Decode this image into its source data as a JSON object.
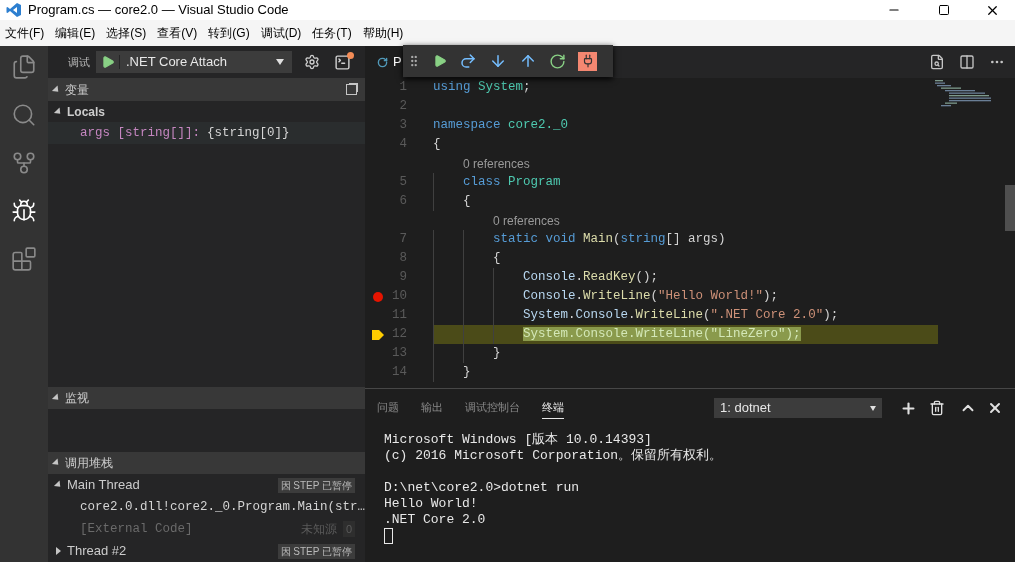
{
  "window": {
    "title": "Program.cs — core2.0 — Visual Studio Code"
  },
  "menu": [
    "文件(F)",
    "编辑(E)",
    "选择(S)",
    "查看(V)",
    "转到(G)",
    "调试(D)",
    "任务(T)",
    "帮助(H)"
  ],
  "activity_bar": [
    {
      "selected": false
    },
    {
      "selected": false
    },
    {
      "selected": false
    },
    {
      "selected": true
    },
    {
      "selected": false
    }
  ],
  "debug": {
    "label": "调试",
    "configuration": ".NET Core Attach"
  },
  "variables": {
    "title": "变量",
    "expanded": true,
    "scopes": [
      {
        "name": "Locals",
        "expanded": true,
        "children": [
          {
            "name": "args [string[]]:",
            "value": "{string[0]}"
          }
        ]
      }
    ]
  },
  "watch": {
    "title": "监视",
    "expanded": true
  },
  "call_stack": {
    "title": "调用堆栈",
    "expanded": true,
    "threads": [
      {
        "name": "Main Thread",
        "expanded": true,
        "badge": "因 STEP 已暂停",
        "children": [
          {
            "name": "core2.0.dll!core2._0.Program.Main(str…",
            "dimmed": false
          },
          {
            "name": "[External Code]",
            "dimmed": true,
            "source": "未知源",
            "line": "0"
          }
        ]
      },
      {
        "name": "Thread #2",
        "expanded": false,
        "badge": "因 STEP 已暂停"
      }
    ]
  },
  "editor": {
    "tab": "P",
    "lines": [
      {
        "number": "1",
        "tokens": [
          {
            "text": "using ",
            "kind": "keyword"
          },
          {
            "text": "System",
            "kind": "type"
          },
          {
            "text": ";"
          }
        ]
      },
      {
        "number": "2"
      },
      {
        "number": "3",
        "tokens": [
          {
            "text": "namespace ",
            "kind": "keyword"
          },
          {
            "text": "core2._0",
            "kind": "type"
          }
        ]
      },
      {
        "number": "4",
        "tokens": [
          {
            "text": "{"
          }
        ]
      },
      {
        "number": "5",
        "lens": "0 references",
        "tokens": [
          {
            "text": "    class ",
            "kind": "keyword"
          },
          {
            "text": "Program",
            "kind": "type"
          }
        ]
      },
      {
        "number": "6",
        "tokens": [
          {
            "text": "    {"
          }
        ]
      },
      {
        "number": "7",
        "lens": "0 references",
        "tokens": [
          {
            "text": "        static void ",
            "kind": "keyword"
          },
          {
            "text": "Main",
            "kind": "function"
          },
          {
            "text": "("
          },
          {
            "text": "string",
            "kind": "keyword"
          },
          {
            "text": "[] args)"
          }
        ]
      },
      {
        "number": "8",
        "tokens": [
          {
            "text": "        {"
          }
        ]
      },
      {
        "number": "9",
        "tokens": [
          {
            "text": "            Console",
            "kind": "ident"
          },
          {
            "text": "."
          },
          {
            "text": "ReadKey",
            "kind": "function"
          },
          {
            "text": "();"
          }
        ]
      },
      {
        "number": "10",
        "breakpoint": true,
        "tokens": [
          {
            "text": "            Console",
            "kind": "ident"
          },
          {
            "text": "."
          },
          {
            "text": "WriteLine",
            "kind": "function"
          },
          {
            "text": "("
          },
          {
            "text": "\"Hello World!\"",
            "kind": "string"
          },
          {
            "text": ");"
          }
        ]
      },
      {
        "number": "11",
        "tokens": [
          {
            "text": "            System",
            "kind": "ident"
          },
          {
            "text": "."
          },
          {
            "text": "Console",
            "kind": "ident"
          },
          {
            "text": "."
          },
          {
            "text": "WriteLine",
            "kind": "function"
          },
          {
            "text": "("
          },
          {
            "text": "\".NET Core 2.0\"",
            "kind": "string"
          },
          {
            "text": ");"
          }
        ]
      },
      {
        "number": "12",
        "current": true,
        "tokens": [
          {
            "text": "            System.Console.WriteLine(\"LineZero\");",
            "kind": "selection"
          }
        ]
      },
      {
        "number": "13",
        "tokens": [
          {
            "text": "        }"
          }
        ]
      },
      {
        "number": "14",
        "tokens": [
          {
            "text": "    }"
          }
        ]
      }
    ]
  },
  "panel": {
    "tabs": [
      {
        "label": "问题",
        "selected": false
      },
      {
        "label": "输出",
        "selected": false
      },
      {
        "label": "调试控制台",
        "selected": false
      },
      {
        "label": "终端",
        "selected": true
      }
    ],
    "terminal_select": "1: dotnet",
    "terminal": [
      [
        "Microsoft Windows [版本 10.0.14393]",
        "(c) 2016 Microsoft Corporation。保留所有权利。"
      ],
      [
        "D:\\net\\core2.0>dotnet run",
        "Hello World!",
        ".NET Core 2.0"
      ]
    ]
  }
}
